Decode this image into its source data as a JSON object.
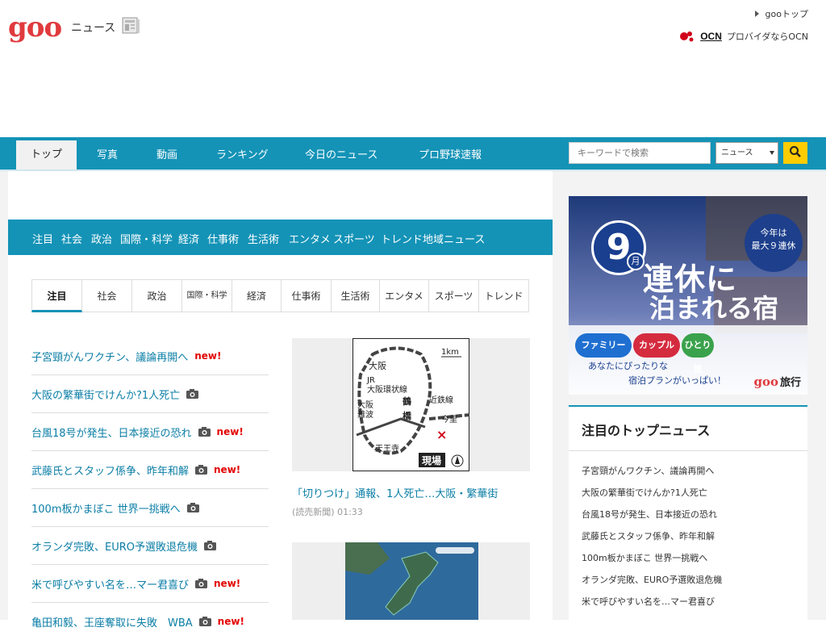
{
  "header": {
    "logo": "goo",
    "logo_sub": "ニュース",
    "goo_top_link": "gooトップ",
    "ocn_logo": "OCN",
    "ocn_link": "プロバイダならOCN"
  },
  "nav": {
    "tabs": [
      "トップ",
      "写真",
      "動画",
      "ランキング",
      "今日のニュース",
      "プロ野球速報"
    ],
    "search_placeholder": "キーワードで検索",
    "select_value": "ニュース"
  },
  "category_bar": [
    "注目",
    "社会",
    "政治",
    "国際・科学",
    "経済",
    "仕事術",
    "生活術",
    "エンタメ",
    "スポーツ",
    "トレンド",
    "地域ニュース"
  ],
  "tabs": [
    "注目",
    "社会",
    "政治",
    "国際・科学",
    "経済",
    "仕事術",
    "生活術",
    "エンタメ",
    "スポーツ",
    "トレンド"
  ],
  "news": [
    {
      "title": "子宮頸がんワクチン、議論再開へ",
      "camera": false,
      "new_label": "new!"
    },
    {
      "title": "大阪の繁華街でけんか?1人死亡",
      "camera": true,
      "new_label": ""
    },
    {
      "title": "台風18号が発生、日本接近の恐れ",
      "camera": true,
      "new_label": "new!"
    },
    {
      "title": "武藤氏とスタッフ係争、昨年和解",
      "camera": true,
      "new_label": "new!"
    },
    {
      "title": "100m板かまぼこ 世界一挑戦へ",
      "camera": true,
      "new_label": ""
    },
    {
      "title": "オランダ完敗、EURO予選敗退危機",
      "camera": true,
      "new_label": ""
    },
    {
      "title": "米で呼びやすい名を…マー君喜び",
      "camera": true,
      "new_label": "new!"
    },
    {
      "title": "亀田和毅、王座奪取に失敗　WBA",
      "camera": true,
      "new_label": "new!"
    }
  ],
  "feature": {
    "map_labels": {
      "scale": "1km",
      "osaka": "大阪",
      "jr": "JR\n大阪環状線",
      "namba": "大阪\n難波",
      "tsuruhashi": "鶴\n橋",
      "kintetsu": "近鉄線",
      "imazato": "今里",
      "tennoji": "天王寺",
      "genba": "現場"
    },
    "caption": "「切りつけ」通報、1人死亡…大阪・繁華街",
    "source": "(読売新聞) 01:33"
  },
  "ad": {
    "nine": "9",
    "month": "月",
    "title_line1": "連休に",
    "title_line2": "泊まれる宿",
    "badge_line1": "今年は",
    "badge_line2": "最大９連休",
    "pills": [
      "ファミリー",
      "カップル",
      "ひとり旅"
    ],
    "tag_line1": "あなたにぴったりな",
    "tag_line2": "宿泊プランがいっぱい！",
    "brand": "goo",
    "brand_sub": "旅行"
  },
  "top_news": {
    "heading": "注目のトップニュース",
    "items": [
      "子宮頸がんワクチン、議論再開へ",
      "大阪の繁華街でけんか?1人死亡",
      "台風18号が発生、日本接近の恐れ",
      "武藤氏とスタッフ係争、昨年和解",
      "100m板かまぼこ 世界一挑戦へ",
      "オランダ完敗、EURO予選敗退危機",
      "米で呼びやすい名を…マー君喜び"
    ]
  },
  "colors": {
    "brand_teal": "#1493b7",
    "logo_red": "#e03a3e",
    "link_blue": "#0b7ea6",
    "new_red": "#e30000",
    "search_yellow": "#ffcc00"
  }
}
